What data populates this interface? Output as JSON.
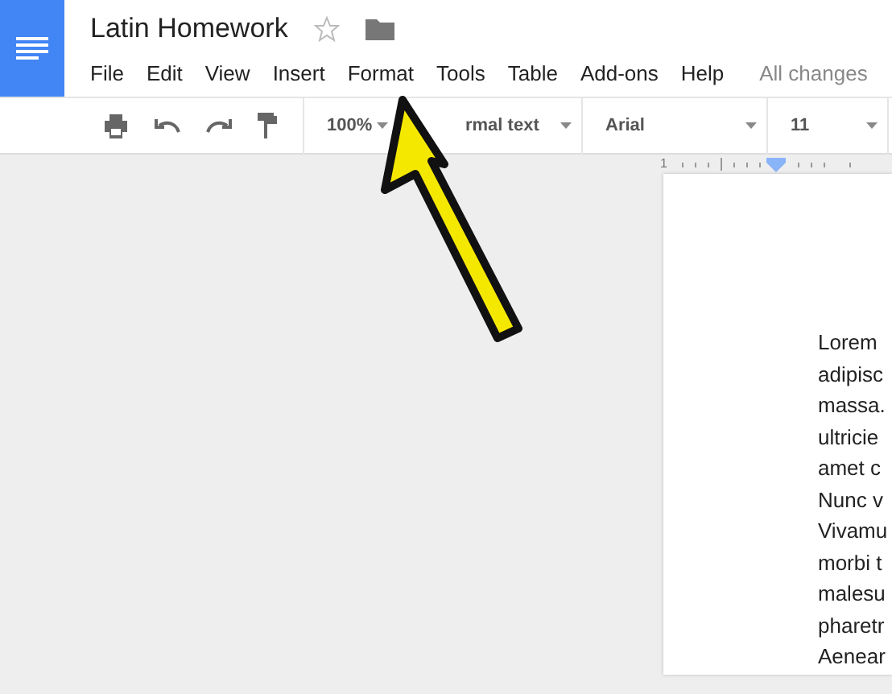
{
  "document": {
    "title": "Latin Homework",
    "starred": false
  },
  "menu": [
    {
      "label": "File"
    },
    {
      "label": "Edit"
    },
    {
      "label": "View"
    },
    {
      "label": "Insert"
    },
    {
      "label": "Format"
    },
    {
      "label": "Tools"
    },
    {
      "label": "Table"
    },
    {
      "label": "Add-ons"
    },
    {
      "label": "Help"
    }
  ],
  "save_status": "All changes",
  "toolbar": {
    "zoom": "100%",
    "style": "rmal text",
    "font": "Arial",
    "size": "11"
  },
  "ruler": {
    "number": "1"
  },
  "page_lines": [
    "Lorem",
    "adipisc",
    "massa.",
    "ultricie",
    "amet c",
    "Nunc v",
    "Vivamu",
    "morbi t",
    "malesu",
    "pharetr",
    "Aenear"
  ]
}
